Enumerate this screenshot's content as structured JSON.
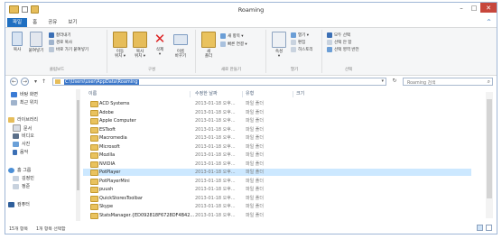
{
  "window": {
    "title": "Roaming",
    "minimize": "–",
    "maximize": "□",
    "close": "✕"
  },
  "ribbon_tabs": [
    "파일",
    "홈",
    "공유",
    "보기"
  ],
  "help_icon": "^",
  "ribbon": {
    "clipboard": {
      "pin_label": "즐겨찾기에\n고정",
      "copy_label": "복사",
      "paste_label": "붙여넣기",
      "cut": "잘라내기",
      "copy_path": "경로 복사",
      "paste_shortcut": "바로 가기 붙여넣기",
      "group": "클립보드"
    },
    "organize": {
      "move_label": "이동\n위치 ▾",
      "copy_to_label": "복사\n위치 ▾",
      "delete_label": "삭제\n▾",
      "rename_label": "이름\n바꾸기",
      "group": "구성"
    },
    "new": {
      "new_folder_label": "새\n폴더",
      "new_item": "새 항목 ▾",
      "easy_access": "빠른 연결 ▾",
      "group": "새로 만들기"
    },
    "open": {
      "properties_label": "속성\n▾",
      "open": "열기 ▾",
      "edit": "편집",
      "history": "히스토리",
      "group": "열기"
    },
    "select": {
      "select_all": "모두 선택",
      "select_none": "선택 안 함",
      "invert": "선택 영역 반전",
      "group": "선택"
    }
  },
  "address": {
    "path": "C:\\Users\\user\\AppData\\Roaming",
    "search_placeholder": "Roaming 검색"
  },
  "nav": {
    "items": [
      {
        "label": "바탕 화면",
        "icon": "desktop-icon"
      },
      {
        "label": "최근 위치",
        "icon": "recent-icon"
      },
      {
        "label": "라이브러리",
        "icon": "library-icon"
      },
      {
        "label": "문서",
        "icon": "documents-icon"
      },
      {
        "label": "비디오",
        "icon": "video-icon"
      },
      {
        "label": "사진",
        "icon": "pictures-icon"
      },
      {
        "label": "음악",
        "icon": "music-icon"
      },
      {
        "label": "홈 그룹",
        "icon": "homegroup-icon"
      },
      {
        "label": "김정민",
        "icon": "user-icon"
      },
      {
        "label": "정준",
        "icon": "user-icon"
      },
      {
        "label": "컴퓨터",
        "icon": "computer-icon"
      }
    ]
  },
  "list": {
    "columns": [
      "이름",
      "수정한 날짜",
      "유형",
      "크기"
    ],
    "rows": [
      {
        "name": "ACD Systems",
        "date": "2013-01-18 오후...",
        "type": "파일 폴더"
      },
      {
        "name": "Adobe",
        "date": "2013-01-18 오후...",
        "type": "파일 폴더"
      },
      {
        "name": "Apple Computer",
        "date": "2013-01-18 오후...",
        "type": "파일 폴더"
      },
      {
        "name": "ESTsoft",
        "date": "2013-01-18 오후...",
        "type": "파일 폴더"
      },
      {
        "name": "Macromedia",
        "date": "2013-01-18 오후...",
        "type": "파일 폴더"
      },
      {
        "name": "Microsoft",
        "date": "2013-01-18 오후...",
        "type": "파일 폴더"
      },
      {
        "name": "Mozilla",
        "date": "2013-01-18 오후...",
        "type": "파일 폴더"
      },
      {
        "name": "NVIDIA",
        "date": "2013-01-18 오후...",
        "type": "파일 폴더"
      },
      {
        "name": "PotPlayer",
        "date": "2013-01-18 오후...",
        "type": "파일 폴더"
      },
      {
        "name": "PotPlayerMini",
        "date": "2013-01-18 오후...",
        "type": "파일 폴더"
      },
      {
        "name": "puush",
        "date": "2013-01-18 오후...",
        "type": "파일 폴더"
      },
      {
        "name": "QuickStoresToolbar",
        "date": "2013-01-18 오후...",
        "type": "파일 폴더"
      },
      {
        "name": "Skype",
        "date": "2013-01-18 오후...",
        "type": "파일 폴더"
      },
      {
        "name": "StatsManager.{ED092818F6728DF4B42...",
        "date": "2013-01-18 오후...",
        "type": "파일 폴더"
      }
    ],
    "selected_index": 8
  },
  "status": {
    "count": "15개 항목",
    "selection": "1개 항목 선택함"
  },
  "colors": {
    "accent": "#1f6fc1",
    "selection": "#cce8ff",
    "folder": "#e9c25e"
  }
}
